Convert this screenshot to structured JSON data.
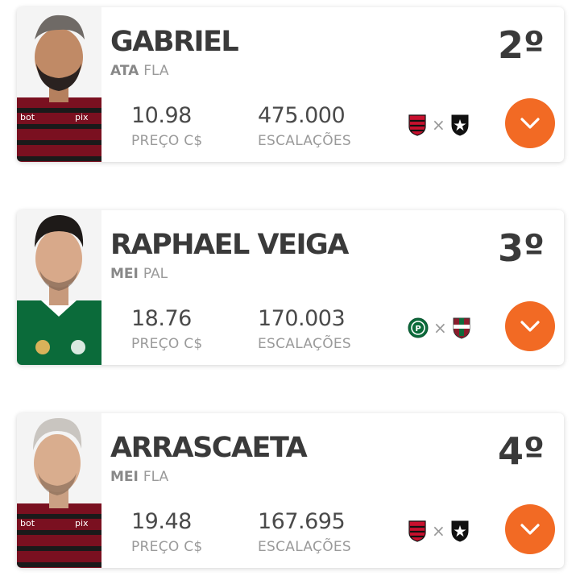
{
  "players": [
    {
      "name": "GABRIEL",
      "position": "ATA",
      "club": "FLA",
      "rank": "2º",
      "price_value": "10.98",
      "price_label": "PREÇO C$",
      "escalacoes_value": "475.000",
      "escalacoes_label": "ESCALAÇÕES",
      "match_home": "flamengo-crest-icon",
      "match_separator": "×",
      "match_away": "botafogo-crest-icon"
    },
    {
      "name": "RAPHAEL VEIGA",
      "position": "MEI",
      "club": "PAL",
      "rank": "3º",
      "price_value": "18.76",
      "price_label": "PREÇO C$",
      "escalacoes_value": "170.003",
      "escalacoes_label": "ESCALAÇÕES",
      "match_home": "palmeiras-crest-icon",
      "match_separator": "×",
      "match_away": "fluminense-crest-icon"
    },
    {
      "name": "ARRASCAETA",
      "position": "MEI",
      "club": "FLA",
      "rank": "4º",
      "price_value": "19.48",
      "price_label": "PREÇO C$",
      "escalacoes_value": "167.695",
      "escalacoes_label": "ESCALAÇÕES",
      "match_home": "flamengo-crest-icon",
      "match_separator": "×",
      "match_away": "botafogo-crest-icon"
    }
  ],
  "colors": {
    "accent": "#f26a24",
    "flamengo_red": "#c8102e",
    "palmeiras_green": "#0b6b3a",
    "text_dark": "#3a3a3a",
    "text_muted": "#9a9a9a"
  }
}
